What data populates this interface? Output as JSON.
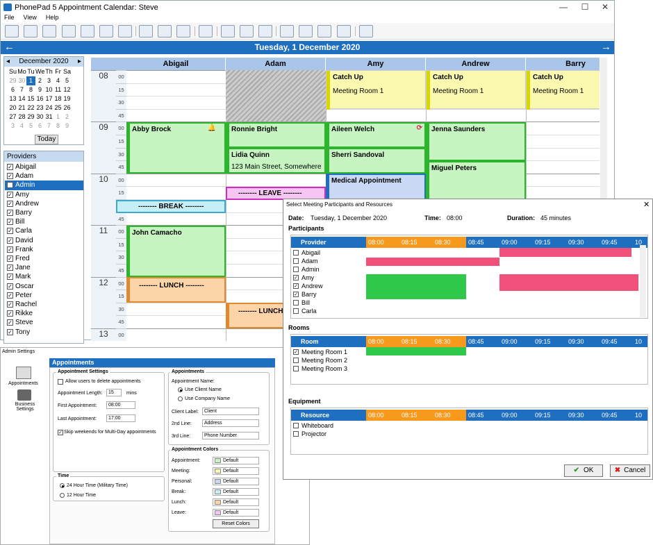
{
  "main": {
    "title": "PhonePad 5 Appointment Calendar: Steve",
    "menu": [
      "File",
      "View",
      "Help"
    ],
    "date": "Tuesday, 1 December 2020"
  },
  "calendar": {
    "month": "December 2020",
    "days": [
      "Su",
      "Mo",
      "Tu",
      "We",
      "Th",
      "Fr",
      "Sa"
    ],
    "weeks": [
      [
        "29",
        "30",
        "1",
        "2",
        "3",
        "4",
        "5"
      ],
      [
        "6",
        "7",
        "8",
        "9",
        "10",
        "11",
        "12"
      ],
      [
        "13",
        "14",
        "15",
        "16",
        "17",
        "18",
        "19"
      ],
      [
        "20",
        "21",
        "22",
        "23",
        "24",
        "25",
        "26"
      ],
      [
        "27",
        "28",
        "29",
        "30",
        "31",
        "1",
        "2"
      ],
      [
        "3",
        "4",
        "5",
        "6",
        "7",
        "8",
        "9"
      ]
    ],
    "today": "Today"
  },
  "providers": {
    "title": "Providers",
    "items": [
      {
        "name": "Abigail",
        "checked": true
      },
      {
        "name": "Adam",
        "checked": true
      },
      {
        "name": "Admin",
        "checked": false,
        "selected": true
      },
      {
        "name": "Amy",
        "checked": true
      },
      {
        "name": "Andrew",
        "checked": true
      },
      {
        "name": "Barry",
        "checked": true
      },
      {
        "name": "Bill",
        "checked": true
      },
      {
        "name": "Carla",
        "checked": true
      },
      {
        "name": "David",
        "checked": true
      },
      {
        "name": "Frank",
        "checked": true
      },
      {
        "name": "Fred",
        "checked": true
      },
      {
        "name": "Jane",
        "checked": true
      },
      {
        "name": "Mark",
        "checked": true
      },
      {
        "name": "Oscar",
        "checked": true
      },
      {
        "name": "Peter",
        "checked": true
      },
      {
        "name": "Rachel",
        "checked": true
      },
      {
        "name": "Rikke",
        "checked": true
      },
      {
        "name": "Steve",
        "checked": true
      },
      {
        "name": "Tony",
        "checked": true
      }
    ]
  },
  "schedule": {
    "columns": [
      "Abigail",
      "Adam",
      "Amy",
      "Andrew",
      "Barry"
    ],
    "hours": [
      "08",
      "09",
      "10",
      "11",
      "12",
      "13"
    ],
    "minutes": [
      "00",
      "15",
      "30",
      "45"
    ],
    "appointments": {
      "catchup_title": "Catch Up",
      "catchup_room": "Meeting Room 1",
      "abby": "Abby Brock",
      "ronnie": "Ronnie Bright",
      "aileen": "Aileen Welch",
      "jenna": "Jenna Saunders",
      "lidia": "Lidia Quinn",
      "lidia_addr": "123 Main Street, Somewhere",
      "sherri": "Sherri Sandoval",
      "miguel": "Miguel Peters",
      "medical": "Medical Appointment",
      "leave": "-------- LEAVE --------",
      "brk": "-------- BREAK --------",
      "john": "John Camacho",
      "lunch": "-------- LUNCH --------",
      "lunch2": "-------- LUNCH --------"
    }
  },
  "colors": {
    "accent": "#1f6fc0",
    "appointment": "#c6f5c2",
    "meeting": "#fbf9b0",
    "personal": "#c8d8f5",
    "break": "#c5eef6",
    "lunch": "#fdd3a8",
    "leave": "#f7c5f2",
    "busy": "#f0507a",
    "free": "#30c84a"
  },
  "admin": {
    "title": "Admin Settings",
    "nav": [
      "Appointments",
      "Business Settings"
    ],
    "header": "Appointments",
    "settings": {
      "group": "Appointment Settings",
      "allow_delete": "Allow users to delete appointments",
      "length_label": "Appointment Length:",
      "length": "15",
      "mins": "mins",
      "first_label": "First Appointment:",
      "first": "08:00",
      "last_label": "Last Appointment:",
      "last": "17:00",
      "skip": "Skip weekends for Multi-Day appointments"
    },
    "time": {
      "group": "Time",
      "opt24": "24 Hour Time (Military Time)",
      "opt12": "12 Hour Time"
    },
    "names": {
      "group": "Appointments",
      "name_label": "Appointment Name:",
      "client": "Use Client Name",
      "company": "Use Company Name",
      "client_label": "Client Label:",
      "client_value": "Client",
      "line2_label": "2nd Line:",
      "line2": "Address",
      "line3_label": "3rd Line:",
      "line3": "Phone Number"
    },
    "colors": {
      "group": "Appointment Colors",
      "items": [
        "Appointment:",
        "Meeting:",
        "Personal:",
        "Break:",
        "Lunch:",
        "Leave:"
      ],
      "value": "Default",
      "reset": "Reset Colors"
    }
  },
  "meeting": {
    "title": "Select Meeting Participants and Resources",
    "date_label": "Date:",
    "date": "Tuesday, 1 December 2020",
    "time_label": "Time:",
    "time": "08:00",
    "dur_label": "Duration:",
    "duration": "45 minutes",
    "participants": {
      "title": "Participants",
      "header": "Provider",
      "rows": [
        {
          "name": "Abigail",
          "checked": false
        },
        {
          "name": "Adam",
          "checked": false
        },
        {
          "name": "Admin",
          "checked": false
        },
        {
          "name": "Amy",
          "checked": true
        },
        {
          "name": "Andrew",
          "checked": true
        },
        {
          "name": "Barry",
          "checked": true
        },
        {
          "name": "Bill",
          "checked": false
        },
        {
          "name": "Carla",
          "checked": false
        }
      ]
    },
    "rooms": {
      "title": "Rooms",
      "header": "Room",
      "rows": [
        {
          "name": "Meeting Room 1",
          "checked": true
        },
        {
          "name": "Meeting Room 2",
          "checked": false
        },
        {
          "name": "Meeting Room 3",
          "checked": false
        }
      ]
    },
    "equipment": {
      "title": "Equipment",
      "header": "Resource",
      "rows": [
        {
          "name": "Whiteboard",
          "checked": false
        },
        {
          "name": "Projector",
          "checked": false
        }
      ]
    },
    "times": [
      "08:00",
      "08:15",
      "08:30",
      "08:45",
      "09:00",
      "09:15",
      "09:30",
      "09:45",
      "10"
    ],
    "ok": "OK",
    "cancel": "Cancel"
  }
}
